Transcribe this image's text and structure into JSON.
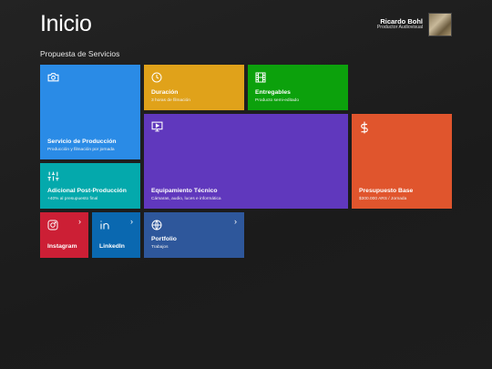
{
  "header": {
    "title": "Inicio",
    "user_name": "Ricardo Bohl",
    "user_role": "Productor Audiovisual"
  },
  "section_title": "Propuesta de Servicios",
  "tiles": {
    "servicio": {
      "name": "Servicio de Producción",
      "sub": "Producción y filmación por jornada",
      "color": "#2a8be6",
      "icon": "camera-icon"
    },
    "duracion": {
      "name": "Duración",
      "sub": "3 horas de filmación",
      "color": "#e0a21a",
      "icon": "clock-icon"
    },
    "entregables": {
      "name": "Entregables",
      "sub": "Producto semi-editado",
      "color": "#0ca10c",
      "icon": "film-icon"
    },
    "equipamiento": {
      "name": "Equipamiento Técnico",
      "sub": "Cámaras, audio, luces e informática",
      "color": "#6038bd",
      "icon": "monitor-play-icon"
    },
    "presupuesto": {
      "name": "Presupuesto Base",
      "sub": "$300.000 ARS / Jornada",
      "color": "#e0552d",
      "icon": "dollar-icon"
    },
    "adicional": {
      "name": "Adicional Post-Producción",
      "sub": "+40% al presupuesto final",
      "color": "#04a9ac",
      "icon": "sliders-icon"
    },
    "instagram": {
      "name": "Instagram",
      "color": "#cc1f35",
      "icon": "instagram-icon",
      "chevron": "›"
    },
    "linkedin": {
      "name": "LinkedIn",
      "color": "#0a68b0",
      "icon": "linkedin-icon",
      "chevron": "›"
    },
    "portfolio": {
      "name": "Portfolio",
      "sub": "Trabajos",
      "color": "#2e579b",
      "icon": "globe-icon",
      "chevron": "›"
    }
  }
}
